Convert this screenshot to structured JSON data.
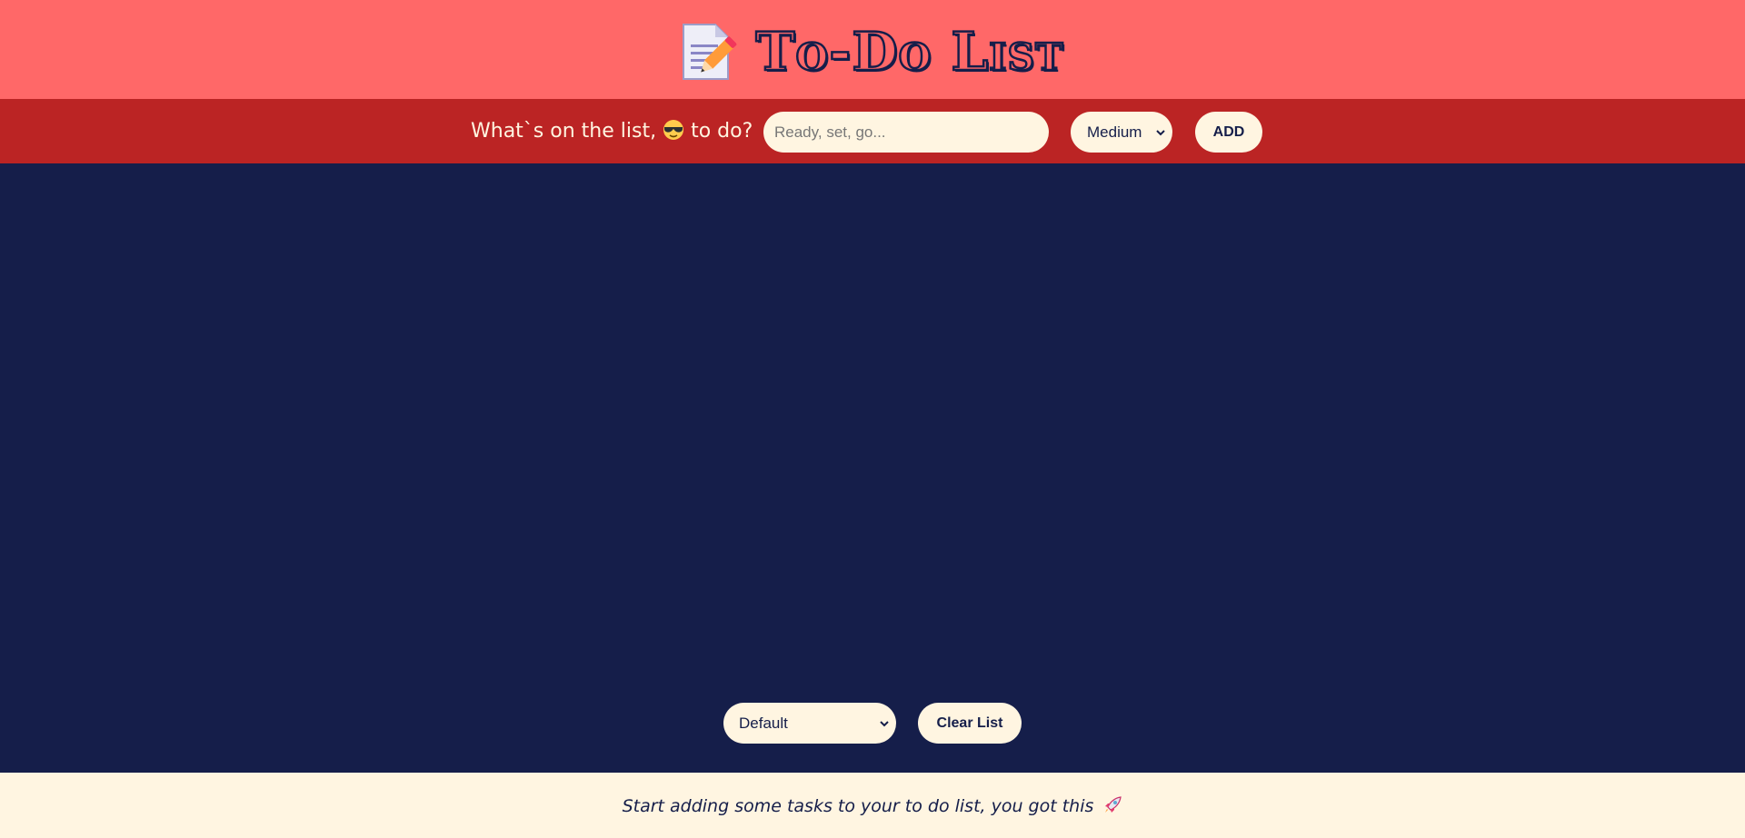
{
  "header": {
    "title": "To-Do List",
    "logo_icon": "memo-pencil-icon"
  },
  "input_bar": {
    "prompt_before": "What`s on the list,",
    "prompt_emoji": "sunglasses-face-icon",
    "prompt_after": "to do?",
    "task_input": {
      "value": "",
      "placeholder": "Ready, set, go..."
    },
    "priority_select": {
      "selected": "Medium"
    },
    "add_label": "ADD"
  },
  "list": {
    "sort_select": {
      "selected": "Default"
    },
    "clear_label": "Clear List"
  },
  "footer": {
    "message": "Start adding some tasks to your to do list, you got this",
    "emoji": "rocket-icon"
  },
  "colors": {
    "header_bg": "#ff6868",
    "bar_bg": "#bb2424",
    "main_bg": "#151e4a",
    "cream": "#fff5e1"
  }
}
